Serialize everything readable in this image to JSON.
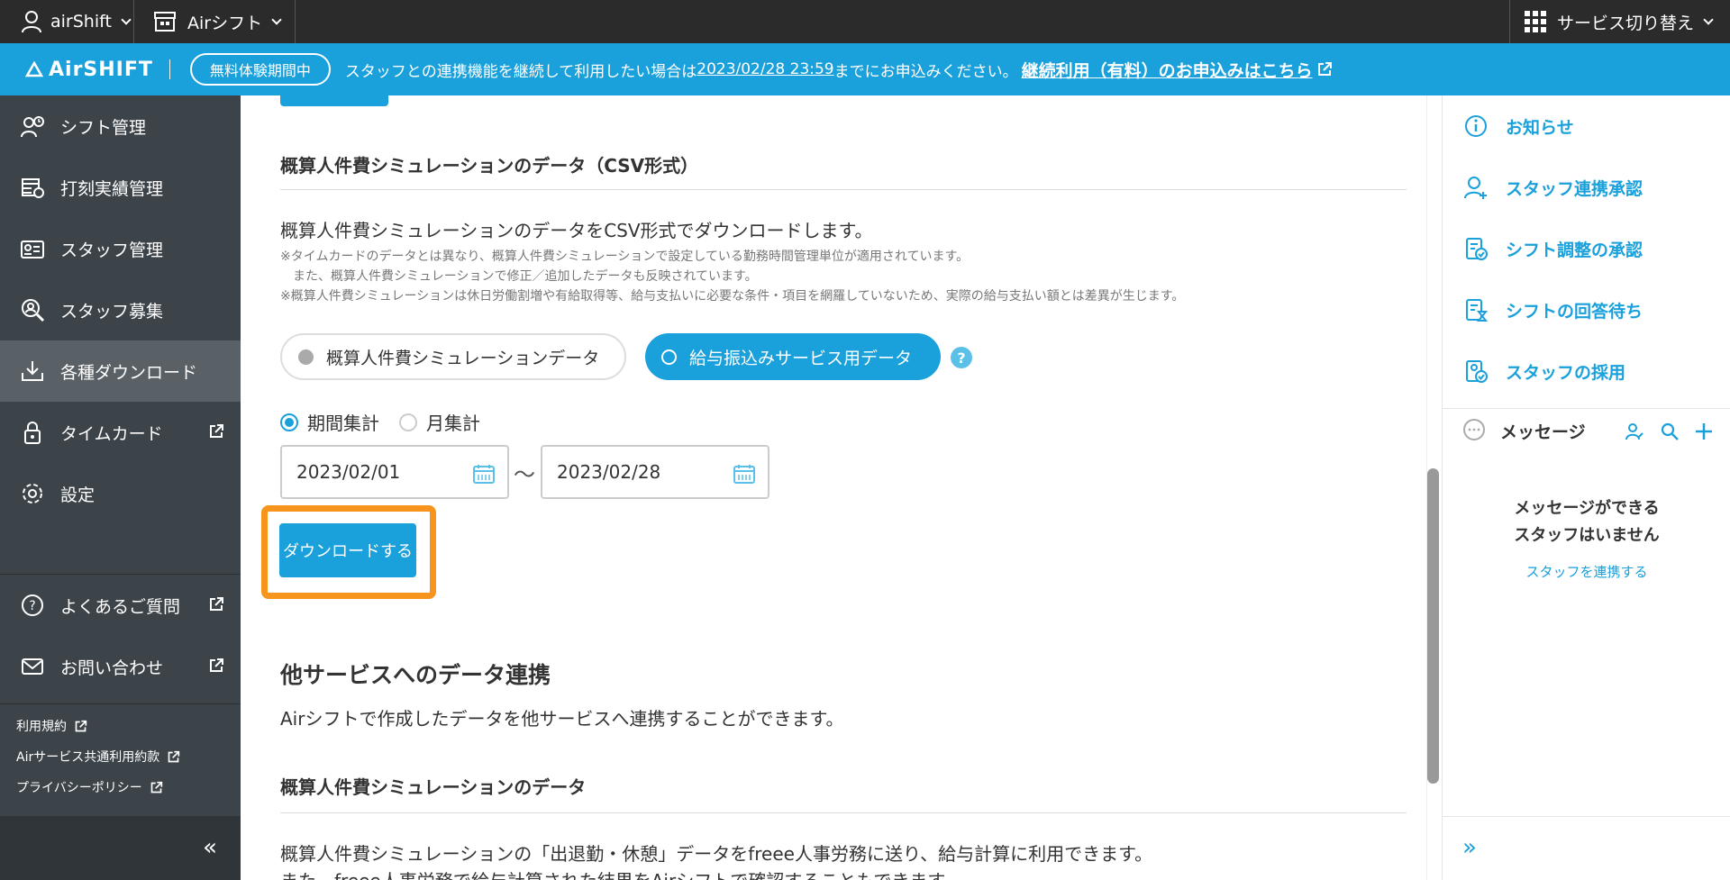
{
  "topbar": {
    "account": "airShift",
    "store": "Airシフト",
    "service_switch": "サービス切り替え"
  },
  "announcement": {
    "logo": "AirSHIFT",
    "trial_badge": "無料体験期間中",
    "text_before": "スタッフとの連携機能を継続して利用したい場合は",
    "deadline": "2023/02/28 23:59",
    "text_after": "までにお申込みください。",
    "link": "継続利用（有料）のお申込みはこちら"
  },
  "sidebar": {
    "items": [
      {
        "label": "シフト管理",
        "icon": "shift-icon"
      },
      {
        "label": "打刻実績管理",
        "icon": "timestamp-icon"
      },
      {
        "label": "スタッフ管理",
        "icon": "staff-card-icon"
      },
      {
        "label": "スタッフ募集",
        "icon": "recruit-icon"
      },
      {
        "label": "各種ダウンロード",
        "icon": "download-icon"
      },
      {
        "label": "タイムカード",
        "icon": "timecard-icon"
      },
      {
        "label": "設定",
        "icon": "gear-icon"
      }
    ],
    "help": [
      {
        "label": "よくあるご質問",
        "icon": "question-icon"
      },
      {
        "label": "お問い合わせ",
        "icon": "mail-icon"
      }
    ],
    "legal": [
      "利用規約",
      "Airサービス共通利用約款",
      "プライバシーポリシー"
    ],
    "collapse": "«"
  },
  "main": {
    "csv_section_title": "概算人件費シミュレーションのデータ（CSV形式）",
    "csv_description": "概算人件費シミュレーションのデータをCSV形式でダウンロードします。",
    "notes": [
      "※タイムカードのデータとは異なり、概算人件費シミュレーションで設定している勤務時間管理単位が適用されています。",
      "　また、概算人件費シミュレーションで修正／追加したデータも反映されています。",
      "※概算人件費シミュレーションは休日労働割増や有給取得等、給与支払いに必要な条件・項目を網羅していないため、実際の給与支払い額とは差異が生じます。"
    ],
    "segment_a": "概算人件費シミュレーションデータ",
    "segment_b": "給与振込みサービス用データ",
    "help_mark": "?",
    "radio_period": "期間集計",
    "radio_month": "月集計",
    "date_from": "2023/02/01",
    "date_sep": "〜",
    "date_to": "2023/02/28",
    "download_button": "ダウンロードする",
    "other_services_title": "他サービスへのデータ連携",
    "other_services_text": "Airシフトで作成したデータを他サービスへ連携することができます。",
    "sim_title": "概算人件費シミュレーションのデータ",
    "sim_text_1": "概算人件費シミュレーションの「出退勤・休憩」データをfreee人事労務に送り、給与計算に利用できます。",
    "sim_text_2": "また、freee人事労務で給与計算された結果をAirシフトで確認することもできます。"
  },
  "right_panel": {
    "items": [
      {
        "label": "お知らせ",
        "icon": "info-icon"
      },
      {
        "label": "スタッフ連携承認",
        "icon": "user-add-icon"
      },
      {
        "label": "シフト調整の承認",
        "icon": "doc-check-icon"
      },
      {
        "label": "シフトの回答待ち",
        "icon": "doc-hourglass-icon"
      },
      {
        "label": "スタッフの採用",
        "icon": "doc-person-icon"
      }
    ],
    "messages_title": "メッセージ",
    "messages_empty_1": "メッセージができる",
    "messages_empty_2": "スタッフはいません",
    "messages_link": "スタッフを連携する",
    "expand": "»"
  },
  "colors": {
    "brand": "#1aa0db",
    "sidebar": "#3d4449",
    "highlight": "#f7941d"
  }
}
